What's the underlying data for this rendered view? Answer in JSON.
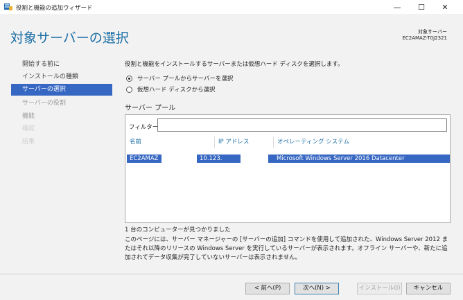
{
  "window": {
    "title": "役割と機能の追加ウィザード",
    "minimize_icon": "minimize-icon",
    "maximize_icon": "maximize-icon",
    "close_icon": "close-icon",
    "minimize_glyph": "—",
    "maximize_glyph": "☐",
    "close_glyph": "✕"
  },
  "header": {
    "page_title": "対象サーバーの選択",
    "destination_label": "対象サーバー",
    "destination_value": "EC2AMAZ-T0J2321"
  },
  "sidebar": {
    "items": [
      {
        "label": "開始する前に",
        "state": "normal"
      },
      {
        "label": "インストールの種類",
        "state": "normal"
      },
      {
        "label": "サーバーの選択",
        "state": "active"
      },
      {
        "label": "サーバーの役割",
        "state": "dim"
      },
      {
        "label": "機能",
        "state": "dim"
      },
      {
        "label": "確認",
        "state": "disabled"
      },
      {
        "label": "結果",
        "state": "disabled"
      }
    ]
  },
  "main": {
    "description": "役割と機能をインストールするサーバーまたは仮想ハード ディスクを選択します。",
    "radio_pool": "サーバー プールからサーバーを選択",
    "radio_vhd": "仮想ハード ディスクから選択",
    "selected_option": "pool",
    "pool_heading": "サーバー プール",
    "filter_label": "フィルター:",
    "filter_value": "",
    "columns": [
      "名前",
      "IP アドレス",
      "オペレーティング システム"
    ],
    "rows": [
      {
        "name": "EC2AMAZ",
        "ip": "10.123.",
        "os": "Microsoft Windows Server 2016 Datacenter"
      }
    ],
    "found_text": "1 台のコンピューターが見つかりました",
    "notice": "このページには、サーバー マネージャーの [サーバーの追加] コマンドを使用して追加された、Windows Server 2012 またはそれ以降のリリースの Windows Server を実行しているサーバーが表示されます。オフライン サーバーや、新たに追加されてデータ収集が完了していないサーバーは表示されません。"
  },
  "footer": {
    "prev": "< 前へ(P)",
    "next": "次へ(N) >",
    "install": "インストール(I)",
    "cancel": "キャンセル"
  },
  "colors": {
    "accent": "#1c6ea4",
    "selection": "#3667c2"
  }
}
